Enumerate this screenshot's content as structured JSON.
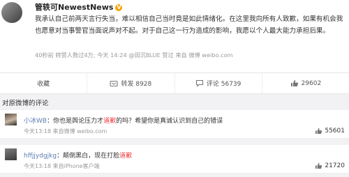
{
  "post": {
    "author": "管轶可NewestNews",
    "badge": "V",
    "text": "我承认自己前两天言行失当，难以相信自己当时竟是如此情绪化。在这里我向所有人致歉，如果有机会我也愿意对当事警官当面说声对不起。对于自己这一行为造成的影响，我愿以个人最大能力承担后果。",
    "meta": "40秒前 转赞人数过4万; 今天 14:24 @田沉BLUE 赞过 来自 微博 weibo.com"
  },
  "actions": {
    "favorite": "收藏",
    "repost": "转发 8928",
    "comment": "评论 56739",
    "like": "29602"
  },
  "comments_section": {
    "title": "对原微博的评论"
  },
  "comments": [
    {
      "user": "小冰WB",
      "text_before": "你也是舆论压力才",
      "highlight": "道歉",
      "text_after": "的吗？希望你是真诚认识到自己的错误",
      "time": "今天13:18 来自微博 weibo.com",
      "likes": "55601"
    },
    {
      "user": "hffjjydgjkg",
      "text_before": "颠倒黑白，现在打脸",
      "highlight": "道歉",
      "text_after": "",
      "time": "今天13:18 来自iPhone客户端",
      "likes": "21720"
    }
  ],
  "colors": {
    "link": "#5b7cb3",
    "highlight": "#ee3333",
    "verified": "#f7a000"
  }
}
